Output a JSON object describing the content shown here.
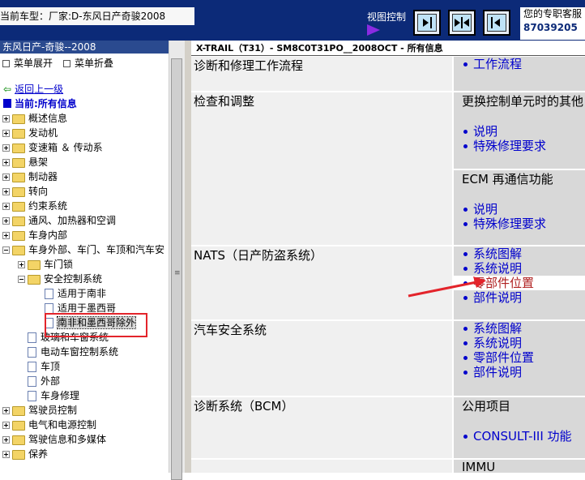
{
  "topbar": {
    "vehicle": "当前车型：厂家:D-东风日产奇骏2008",
    "view_control_label": "视图控制",
    "service_line1": "您的专职客服",
    "service_number": "87039205"
  },
  "left_panel": {
    "header": "东风日产-奇骏--2008",
    "expand_all": "菜单展开",
    "collapse_all": "菜单折叠",
    "back": "返回上一级",
    "current": "当前:所有信息",
    "tree": [
      {
        "label": "概述信息",
        "type": "folder",
        "expand": "plus",
        "indent": 0
      },
      {
        "label": "发动机",
        "type": "folder",
        "expand": "plus",
        "indent": 0
      },
      {
        "label": "变速箱 ＆ 传动系",
        "type": "folder",
        "expand": "plus",
        "indent": 0
      },
      {
        "label": "悬架",
        "type": "folder",
        "expand": "plus",
        "indent": 0
      },
      {
        "label": "制动器",
        "type": "folder",
        "expand": "plus",
        "indent": 0
      },
      {
        "label": "转向",
        "type": "folder",
        "expand": "plus",
        "indent": 0
      },
      {
        "label": "约束系统",
        "type": "folder",
        "expand": "plus",
        "indent": 0
      },
      {
        "label": "通风、加热器和空调",
        "type": "folder",
        "expand": "plus",
        "indent": 0
      },
      {
        "label": "车身内部",
        "type": "folder",
        "expand": "plus",
        "indent": 0
      },
      {
        "label": "车身外部、车门、车顶和汽车安",
        "type": "folder",
        "expand": "minus",
        "indent": 0
      },
      {
        "label": "车门锁",
        "type": "folder",
        "expand": "plus",
        "indent": 1
      },
      {
        "label": "安全控制系统",
        "type": "folder",
        "expand": "minus",
        "indent": 1
      },
      {
        "label": "适用于南非",
        "type": "page",
        "expand": "",
        "indent": 2
      },
      {
        "label": "适用于墨西哥",
        "type": "page",
        "expand": "",
        "indent": 2
      },
      {
        "label": "南非和墨西哥除外",
        "type": "page",
        "expand": "",
        "indent": 2,
        "selected": true
      },
      {
        "label": "玻璃和车窗系统",
        "type": "page",
        "expand": "",
        "indent": 1
      },
      {
        "label": "电动车窗控制系统",
        "type": "page",
        "expand": "",
        "indent": 1
      },
      {
        "label": "车顶",
        "type": "page",
        "expand": "",
        "indent": 1
      },
      {
        "label": "外部",
        "type": "page",
        "expand": "",
        "indent": 1
      },
      {
        "label": "车身修理",
        "type": "page",
        "expand": "",
        "indent": 1
      },
      {
        "label": "驾驶员控制",
        "type": "folder",
        "expand": "plus",
        "indent": 0
      },
      {
        "label": "电气和电源控制",
        "type": "folder",
        "expand": "plus",
        "indent": 0
      },
      {
        "label": "驾驶信息和多媒体",
        "type": "folder",
        "expand": "plus",
        "indent": 0
      },
      {
        "label": "保养",
        "type": "folder",
        "expand": "plus",
        "indent": 0
      }
    ]
  },
  "document": {
    "header": "X-TRAIL（T31）- SM8C0T31PO__2008OCT - 所有信息",
    "rows": [
      {
        "section": "诊断和修理工作流程",
        "blocks": [
          {
            "title": "",
            "links": [
              "工作流程"
            ]
          }
        ]
      },
      {
        "section": "检查和调整",
        "blocks": [
          {
            "title": "更换控制单元时的其他",
            "links": [
              "说明",
              "特殊修理要求"
            ]
          },
          {
            "title": "ECM 再通信功能",
            "links": [
              "说明",
              "特殊修理要求"
            ]
          }
        ]
      },
      {
        "section": "NATS（日产防盗系统）",
        "blocks": [
          {
            "title": "",
            "links": [
              "系统图解",
              "系统说明",
              "零部件位置",
              "部件说明"
            ],
            "highlight": 2
          }
        ]
      },
      {
        "section": "汽车安全系统",
        "blocks": [
          {
            "title": "",
            "links": [
              "系统图解",
              "系统说明",
              "零部件位置",
              "部件说明"
            ]
          }
        ]
      },
      {
        "section": "诊断系统（BCM）",
        "blocks": [
          {
            "title": "公用项目",
            "links": [
              "CONSULT-III 功能"
            ]
          }
        ]
      },
      {
        "section": "",
        "blocks": [
          {
            "title": "IMMU",
            "links": []
          }
        ]
      }
    ]
  },
  "colors": {
    "top_bar": "#0c2a78",
    "link": "#0000cc",
    "highlight_link": "#b02020",
    "annotation_red": "#e3242b"
  }
}
